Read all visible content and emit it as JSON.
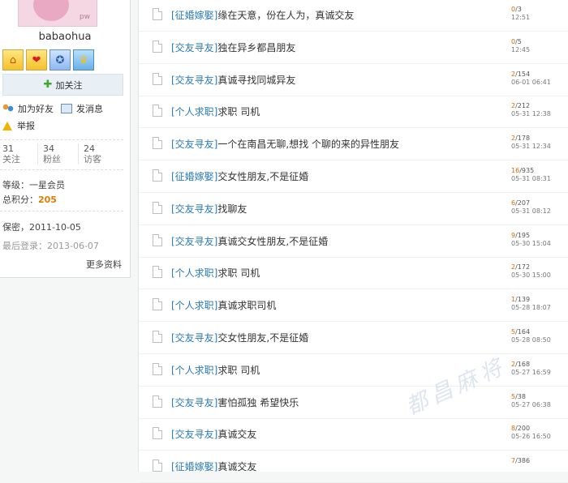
{
  "profile": {
    "avatar_text": "pw",
    "username": "babaohua",
    "follow_label": "加关注",
    "add_friend_label": "加为好友",
    "message_label": "发消息",
    "report_label": "举报",
    "stats": [
      {
        "value": "31",
        "label": "关注"
      },
      {
        "value": "34",
        "label": "粉丝"
      },
      {
        "value": "24",
        "label": "访客"
      }
    ],
    "level_label": "等级：",
    "level_value": "一星会员",
    "points_label": "总积分：",
    "points_value": "205",
    "birthday_label": "保密，",
    "birthday_value": "2011-10-05",
    "last_login_label": "最后登录：",
    "last_login_value": "2013-06-07",
    "more_label": "更多资料"
  },
  "badges": [
    "house-icon",
    "heart-icon",
    "medal-icon",
    "trophy-icon"
  ],
  "posts": [
    {
      "category": "[征婚嫁娶]",
      "title": "缘在天意，份在人为，真诚交友",
      "replies": "0",
      "views": "3",
      "date": "12:51"
    },
    {
      "category": "[交友寻友]",
      "title": "独在异乡都昌朋友",
      "replies": "0",
      "views": "5",
      "date": "12:45"
    },
    {
      "category": "[交友寻友]",
      "title": "真诚寻找同城异友",
      "replies": "2",
      "views": "154",
      "date": "06-01 06:41"
    },
    {
      "category": "[个人求职]",
      "title": "求职 司机",
      "replies": "2",
      "views": "212",
      "date": "05-31 12:38"
    },
    {
      "category": "[交友寻友]",
      "title": "一个在南昌无聊,想找 个聊的来的异性朋友",
      "replies": "2",
      "views": "178",
      "date": "05-31 12:34"
    },
    {
      "category": "[征婚嫁娶]",
      "title": "交女性朋友,不是征婚",
      "replies": "16",
      "views": "935",
      "date": "05-31 08:31"
    },
    {
      "category": "[交友寻友]",
      "title": "找聊友",
      "replies": "6",
      "views": "207",
      "date": "05-31 08:12"
    },
    {
      "category": "[交友寻友]",
      "title": "真诚交女性朋友,不是征婚",
      "replies": "9",
      "views": "195",
      "date": "05-30 15:04"
    },
    {
      "category": "[个人求职]",
      "title": "求职 司机",
      "replies": "2",
      "views": "172",
      "date": "05-30 15:00"
    },
    {
      "category": "[个人求职]",
      "title": "真诚求职司机",
      "replies": "1",
      "views": "139",
      "date": "05-28 18:07"
    },
    {
      "category": "[交友寻友]",
      "title": "交女性朋友,不是征婚",
      "replies": "5",
      "views": "164",
      "date": "05-28 08:50"
    },
    {
      "category": "[个人求职]",
      "title": "求职 司机",
      "replies": "2",
      "views": "168",
      "date": "05-27 16:59"
    },
    {
      "category": "[交友寻友]",
      "title": "害怕孤独 希望快乐",
      "replies": "5",
      "views": "38",
      "date": "05-27 06:38"
    },
    {
      "category": "[交友寻友]",
      "title": "真诚交友",
      "replies": "8",
      "views": "200",
      "date": "05-26 16:50"
    },
    {
      "category": "[征婚嫁娶]",
      "title": "真诚交友",
      "replies": "7",
      "views": "386",
      "date": ""
    }
  ],
  "watermark": "都昌麻将"
}
